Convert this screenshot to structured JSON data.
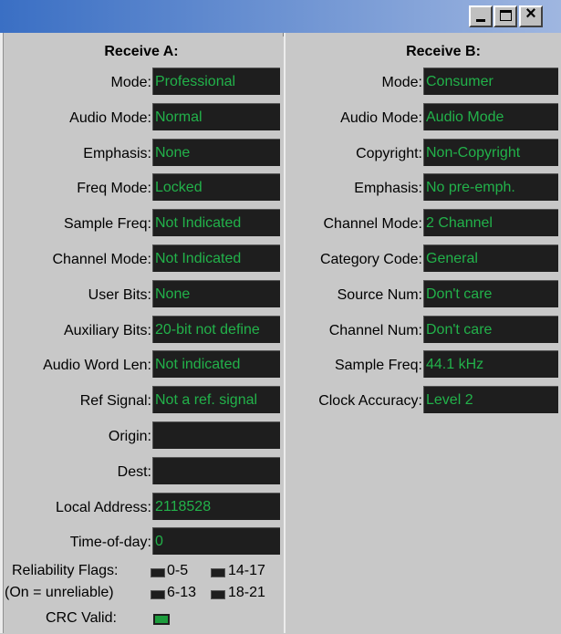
{
  "window": {
    "controls": {
      "minimize_icon": "minimize-icon",
      "maximize_icon": "maximize-icon",
      "close_label": "×"
    }
  },
  "receive_a": {
    "title": "Receive A:",
    "fields": [
      {
        "label": "Mode:",
        "value": "Professional"
      },
      {
        "label": "Audio Mode:",
        "value": "Normal"
      },
      {
        "label": "Emphasis:",
        "value": "None"
      },
      {
        "label": "Freq Mode:",
        "value": "Locked"
      },
      {
        "label": "Sample Freq:",
        "value": "Not Indicated"
      },
      {
        "label": "Channel Mode:",
        "value": "Not Indicated"
      },
      {
        "label": "User Bits:",
        "value": "None"
      },
      {
        "label": "Auxiliary Bits:",
        "value": "20-bit not define"
      },
      {
        "label": "Audio Word Len:",
        "value": "Not indicated"
      },
      {
        "label": "Ref Signal:",
        "value": "Not a ref. signal"
      },
      {
        "label": "Origin:",
        "value": ""
      },
      {
        "label": "Dest:",
        "value": ""
      },
      {
        "label": "Local Address:",
        "value": "2118528"
      },
      {
        "label": "Time-of-day:",
        "value": "0"
      }
    ],
    "reliability": {
      "label_line1": "Reliability Flags:",
      "label_line2": "(On = unreliable)",
      "flags": [
        "0-5",
        "14-17",
        "6-13",
        "18-21"
      ]
    },
    "crc": {
      "label": "CRC Valid:",
      "state": "on"
    }
  },
  "receive_b": {
    "title": "Receive B:",
    "fields": [
      {
        "label": "Mode:",
        "value": "Consumer"
      },
      {
        "label": "Audio Mode:",
        "value": "Audio Mode"
      },
      {
        "label": "Copyright:",
        "value": "Non-Copyright"
      },
      {
        "label": "Emphasis:",
        "value": "No pre-emph."
      },
      {
        "label": "Channel Mode:",
        "value": "2 Channel"
      },
      {
        "label": "Category Code:",
        "value": "General"
      },
      {
        "label": "Source Num:",
        "value": "Don't care"
      },
      {
        "label": "Channel Num:",
        "value": "Don't care"
      },
      {
        "label": "Sample Freq:",
        "value": "44.1 kHz"
      },
      {
        "label": "Clock Accuracy:",
        "value": "Level 2"
      }
    ]
  },
  "colors": {
    "value_text": "#22b24a",
    "value_bg": "#1e1e1e",
    "panel_bg": "#c8c8c8",
    "titlebar_start": "#3a6fc4",
    "titlebar_end": "#9fb6e0"
  }
}
